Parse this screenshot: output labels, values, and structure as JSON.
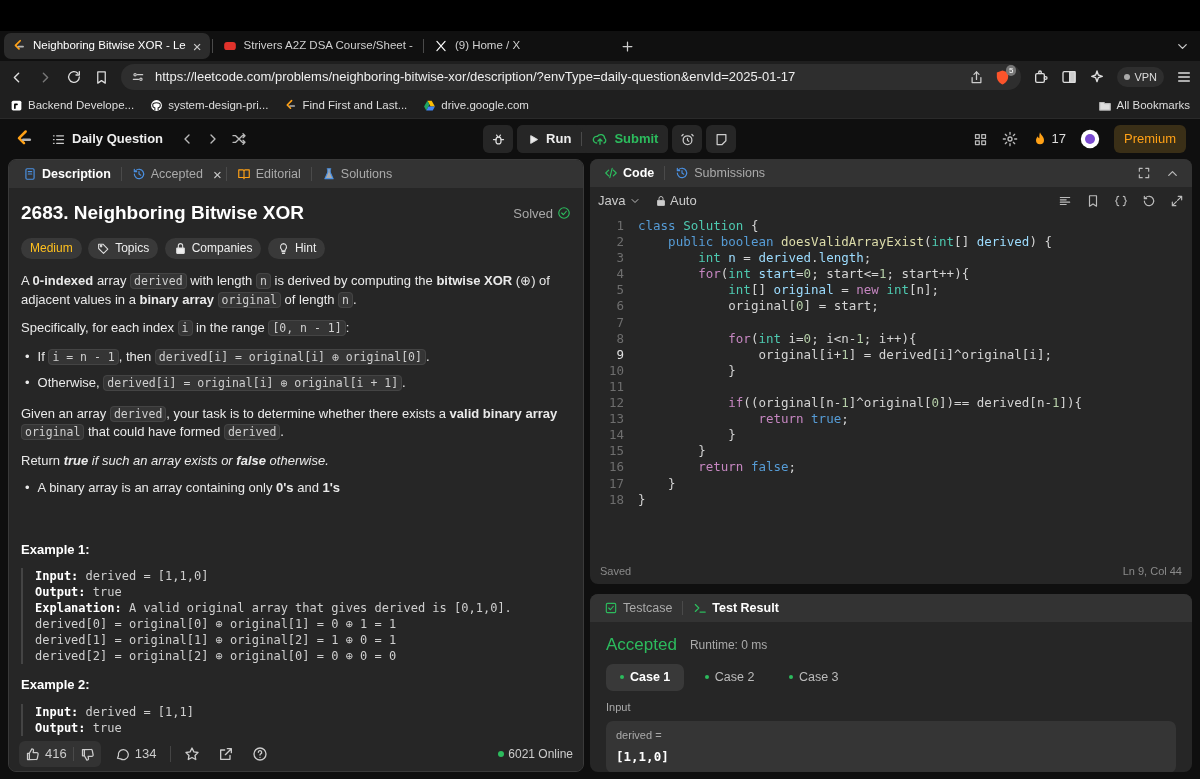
{
  "browser": {
    "tabs": [
      {
        "title": "Neighboring Bitwise XOR - Le",
        "selected": true,
        "close": "×"
      },
      {
        "title": "Strivers A2Z DSA Course/Sheet -",
        "selected": false
      },
      {
        "title": "(9) Home / X",
        "selected": false
      }
    ],
    "url": "https://leetcode.com/problems/neighboring-bitwise-xor/description/?envType=daily-question&envId=2025-01-17",
    "shield_badge": "5",
    "vpn": "VPN",
    "bookmarks": [
      "Backend Develope...",
      "system-design-pri...",
      "Find First and Last...",
      "drive.google.com"
    ],
    "all_bookmarks": "All Bookmarks"
  },
  "header": {
    "title": "Daily Question",
    "run": "Run",
    "submit": "Submit",
    "streak": "17",
    "premium": "Premium"
  },
  "description_panel": {
    "tabs": [
      {
        "label": "Description",
        "selected": true
      },
      {
        "label": "Accepted",
        "selected": false,
        "close": "×"
      },
      {
        "label": "Editorial",
        "selected": false
      },
      {
        "label": "Solutions",
        "selected": false
      }
    ],
    "title": "2683. Neighboring Bitwise XOR",
    "status": "Solved",
    "tags": [
      {
        "label": "Medium",
        "kind": "difficulty"
      },
      {
        "label": "Topics",
        "kind": "topics"
      },
      {
        "label": "Companies",
        "kind": "companies"
      },
      {
        "label": "Hint",
        "kind": "hint"
      }
    ],
    "content": [
      {
        "kind": "para",
        "segments": [
          {
            "t": "A **0-indexed** array "
          },
          {
            "code": "derived"
          },
          {
            "t": " with length "
          },
          {
            "code": "n"
          },
          {
            "t": " is derived by computing the **bitwise XOR** (⊕) of adjacent values in a **binary array** "
          },
          {
            "code": "original"
          },
          {
            "t": " of length "
          },
          {
            "code": "n"
          },
          {
            "t": "."
          }
        ]
      },
      {
        "kind": "para",
        "segments": [
          {
            "t": "Specifically, for each index "
          },
          {
            "code": "i"
          },
          {
            "t": " in the range "
          },
          {
            "code": "[0, n - 1]"
          },
          {
            "t": ":"
          }
        ]
      },
      {
        "kind": "bullets",
        "items": [
          {
            "marker": "•",
            "segments": [
              {
                "t": "If "
              },
              {
                "code": "i = n - 1"
              },
              {
                "t": ", then "
              },
              {
                "code": "derived[i] = original[i] ⊕ original[0]"
              },
              {
                "t": "."
              }
            ]
          },
          {
            "marker": "•",
            "segments": [
              {
                "t": "Otherwise, "
              },
              {
                "code": "derived[i] = original[i] ⊕ original[i + 1]"
              },
              {
                "t": "."
              }
            ]
          }
        ]
      },
      {
        "kind": "para",
        "segments": [
          {
            "t": "Given an array "
          },
          {
            "code": "derived"
          },
          {
            "t": ", your task is to determine whether there exists a **valid binary array** "
          },
          {
            "code": "original"
          },
          {
            "t": " that could have formed "
          },
          {
            "code": "derived"
          },
          {
            "t": "."
          }
        ]
      },
      {
        "kind": "para",
        "segments": [
          {
            "t": "Return "
          },
          {
            "t": "**true** if such an array exists or **false** otherwise.",
            "italic": true
          }
        ]
      },
      {
        "kind": "bullets",
        "items": [
          {
            "marker": "•",
            "segments": [
              {
                "t": "A binary array is an array containing only **0's** and **1's**"
              }
            ]
          }
        ]
      },
      {
        "kind": "heading",
        "text": "Example 1:"
      },
      {
        "kind": "example",
        "lines": [
          {
            "label": "Input:",
            "text": " derived = [1,1,0]"
          },
          {
            "label": "Output:",
            "text": " true"
          },
          {
            "label": "Explanation:",
            "text": " A valid original array that gives derived is [0,1,0]."
          },
          {
            "text": "derived[0] = original[0] ⊕ original[1] = 0 ⊕ 1 = 1"
          },
          {
            "text": "derived[1] = original[1] ⊕ original[2] = 1 ⊕ 0 = 1"
          },
          {
            "text": "derived[2] = original[2] ⊕ original[0] = 0 ⊕ 0 = 0"
          }
        ]
      },
      {
        "kind": "heading",
        "text": "Example 2:"
      },
      {
        "kind": "example",
        "lines": [
          {
            "label": "Input:",
            "text": " derived = [1,1]"
          },
          {
            "label": "Output:",
            "text": " true"
          }
        ]
      }
    ],
    "likes": "416",
    "comments": "134",
    "online": "6021 Online"
  },
  "code_panel": {
    "tabs": [
      {
        "label": "Code",
        "selected": true
      },
      {
        "label": "Submissions",
        "selected": false
      }
    ],
    "language": "Java",
    "mode": "Auto",
    "lines": [
      {
        "num": "1",
        "active": false,
        "tokens": [
          {
            "kind": "keyword",
            "text": "class "
          },
          {
            "kind": "type",
            "text": "Solution"
          },
          {
            "kind": "plain",
            "text": " {"
          }
        ]
      },
      {
        "num": "2",
        "active": false,
        "tokens": [
          {
            "kind": "keyword",
            "text": "    public boolean "
          },
          {
            "kind": "function",
            "text": "doesValidArrayExist"
          },
          {
            "kind": "plain",
            "text": "("
          },
          {
            "kind": "type",
            "text": "int"
          },
          {
            "kind": "plain",
            "text": "[] "
          },
          {
            "kind": "variable",
            "text": "derived"
          },
          {
            "kind": "plain",
            "text": ") {"
          }
        ]
      },
      {
        "num": "3",
        "active": false,
        "tokens": [
          {
            "kind": "type",
            "text": "        int "
          },
          {
            "kind": "variable",
            "text": "n"
          },
          {
            "kind": "plain",
            "text": " = "
          },
          {
            "kind": "variable",
            "text": "derived"
          },
          {
            "kind": "plain",
            "text": "."
          },
          {
            "kind": "variable",
            "text": "length"
          },
          {
            "kind": "plain",
            "text": ";"
          }
        ]
      },
      {
        "num": "4",
        "active": false,
        "tokens": [
          {
            "kind": "control",
            "text": "        for"
          },
          {
            "kind": "plain",
            "text": "("
          },
          {
            "kind": "type",
            "text": "int "
          },
          {
            "kind": "variable",
            "text": "start"
          },
          {
            "kind": "plain",
            "text": "="
          },
          {
            "kind": "number",
            "text": "0"
          },
          {
            "kind": "plain",
            "text": "; start<="
          },
          {
            "kind": "number",
            "text": "1"
          },
          {
            "kind": "plain",
            "text": "; start++){"
          }
        ]
      },
      {
        "num": "5",
        "active": false,
        "tokens": [
          {
            "kind": "type",
            "text": "            int"
          },
          {
            "kind": "plain",
            "text": "[] "
          },
          {
            "kind": "variable",
            "text": "original"
          },
          {
            "kind": "plain",
            "text": " = "
          },
          {
            "kind": "control",
            "text": "new "
          },
          {
            "kind": "type",
            "text": "int"
          },
          {
            "kind": "plain",
            "text": "[n];"
          }
        ]
      },
      {
        "num": "6",
        "active": false,
        "tokens": [
          {
            "kind": "plain",
            "text": "            original["
          },
          {
            "kind": "number",
            "text": "0"
          },
          {
            "kind": "plain",
            "text": "] = start;"
          }
        ]
      },
      {
        "num": "7",
        "active": false
      },
      {
        "num": "8",
        "active": false,
        "tokens": [
          {
            "kind": "control",
            "text": "            for"
          },
          {
            "kind": "plain",
            "text": "("
          },
          {
            "kind": "type",
            "text": "int "
          },
          {
            "kind": "plain",
            "text": "i="
          },
          {
            "kind": "number",
            "text": "0"
          },
          {
            "kind": "plain",
            "text": "; i<n-"
          },
          {
            "kind": "number",
            "text": "1"
          },
          {
            "kind": "plain",
            "text": "; i++){"
          }
        ]
      },
      {
        "num": "9",
        "active": true,
        "tokens": [
          {
            "kind": "plain",
            "text": "                original[i+"
          },
          {
            "kind": "number",
            "text": "1"
          },
          {
            "kind": "plain",
            "text": "] = derived[i]^original[i];"
          }
        ]
      },
      {
        "num": "10",
        "active": false,
        "tokens": [
          {
            "kind": "plain",
            "text": "            }"
          }
        ]
      },
      {
        "num": "11",
        "active": false
      },
      {
        "num": "12",
        "active": false,
        "tokens": [
          {
            "kind": "control",
            "text": "            if"
          },
          {
            "kind": "plain",
            "text": "((original[n-"
          },
          {
            "kind": "number",
            "text": "1"
          },
          {
            "kind": "plain",
            "text": "]^original["
          },
          {
            "kind": "number",
            "text": "0"
          },
          {
            "kind": "plain",
            "text": "])== derived[n-"
          },
          {
            "kind": "number",
            "text": "1"
          },
          {
            "kind": "plain",
            "text": "]){"
          }
        ]
      },
      {
        "num": "13",
        "active": false,
        "tokens": [
          {
            "kind": "control",
            "text": "                return "
          },
          {
            "kind": "keyword",
            "text": "true"
          },
          {
            "kind": "plain",
            "text": ";"
          }
        ]
      },
      {
        "num": "14",
        "active": false,
        "tokens": [
          {
            "kind": "plain",
            "text": "            }"
          }
        ]
      },
      {
        "num": "15",
        "active": false,
        "tokens": [
          {
            "kind": "plain",
            "text": "        }"
          }
        ]
      },
      {
        "num": "16",
        "active": false,
        "tokens": [
          {
            "kind": "control",
            "text": "        return "
          },
          {
            "kind": "keyword",
            "text": "false"
          },
          {
            "kind": "plain",
            "text": ";"
          }
        ]
      },
      {
        "num": "17",
        "active": false,
        "tokens": [
          {
            "kind": "plain",
            "text": "    }"
          }
        ]
      },
      {
        "num": "18",
        "active": false,
        "tokens": [
          {
            "kind": "plain",
            "text": "}"
          }
        ]
      }
    ],
    "status": "Saved",
    "cursor": "Ln 9, Col 44"
  },
  "result_panel": {
    "tabs": [
      {
        "label": "Testcase",
        "selected": false
      },
      {
        "label": "Test Result",
        "selected": true
      }
    ],
    "verdict": "Accepted",
    "runtime": "Runtime: 0 ms",
    "cases": [
      {
        "label": "Case 1",
        "selected": true
      },
      {
        "label": "Case 2",
        "selected": false
      },
      {
        "label": "Case 3",
        "selected": false
      }
    ],
    "input_label": "Input",
    "param_name": "derived =",
    "param_value": "[1,1,0]"
  }
}
